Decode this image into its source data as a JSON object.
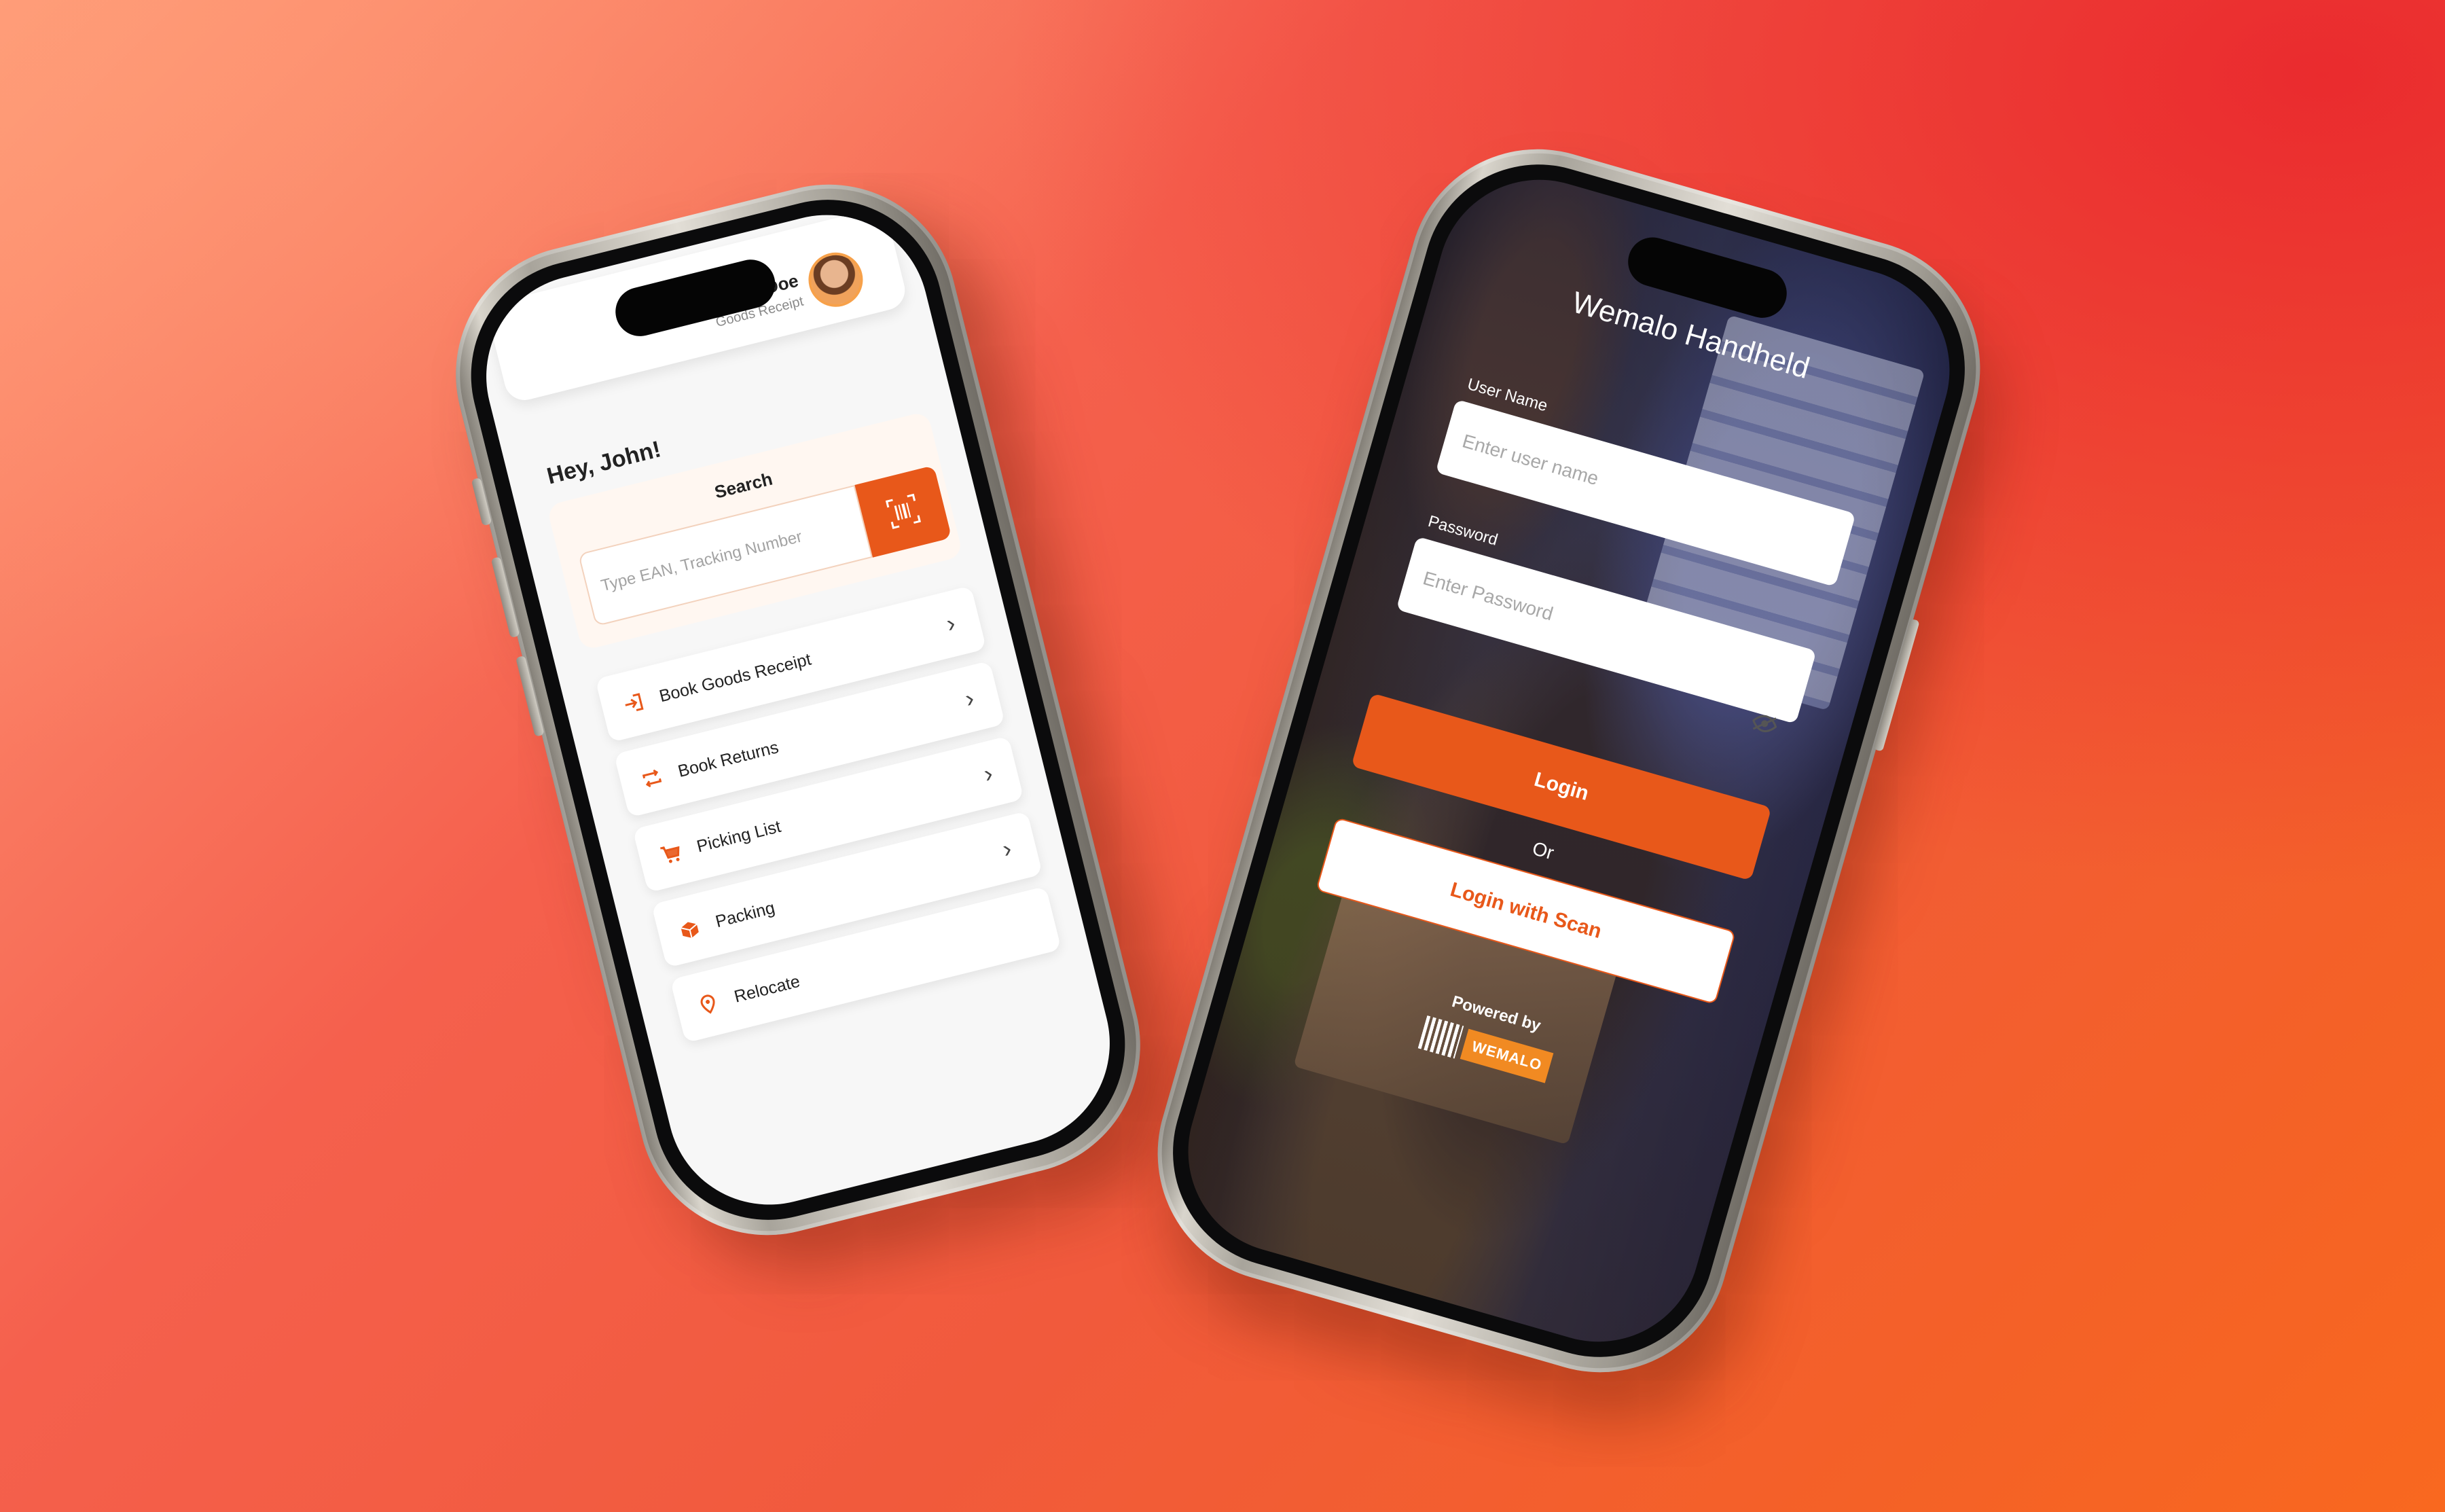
{
  "colors": {
    "accent": "#e8581a",
    "brand_orange": "#f18a22",
    "background_start": "#ff9878",
    "background_end": "#f9681f",
    "background_corner": "#e9232c"
  },
  "left_phone": {
    "header": {
      "user_name": "Doe",
      "user_role": "Goods Receipt",
      "avatar_icon": "user-avatar"
    },
    "greeting": "Hey, John!",
    "search": {
      "title": "Search",
      "placeholder": "Type EAN, Tracking Number",
      "scan_icon": "barcode-scan-icon"
    },
    "menu": [
      {
        "label": "Book Goods Receipt",
        "icon": "sign-in-icon"
      },
      {
        "label": "Book Returns",
        "icon": "repeat-icon"
      },
      {
        "label": "Picking List",
        "icon": "cart-icon"
      },
      {
        "label": "Packing",
        "icon": "package-icon"
      },
      {
        "label": "Relocate",
        "icon": "location-pin-icon"
      }
    ]
  },
  "right_phone": {
    "title": "Wemalo Handheld",
    "username_label": "User Name",
    "username_placeholder": "Enter user name",
    "password_label": "Password",
    "password_placeholder": "Enter Password",
    "password_toggle_icon": "eye-off-icon",
    "login_label": "Login",
    "or_label": "Or",
    "login_scan_label": "Login with Scan",
    "powered_by": "Powered by",
    "brand": "WEMALO"
  }
}
